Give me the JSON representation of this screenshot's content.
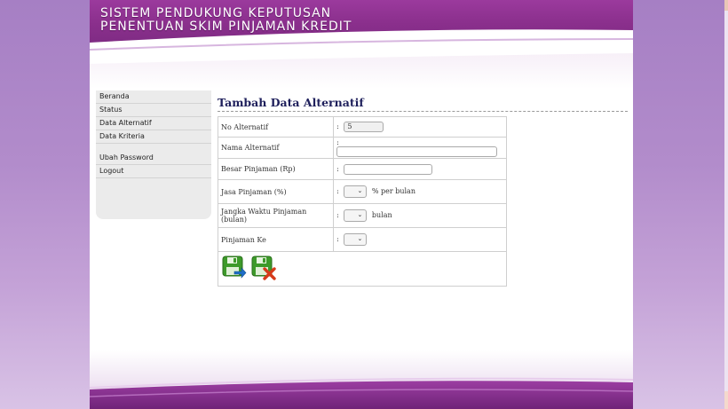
{
  "header": {
    "title_line1": "SISTEM PENDUKUNG KEPUTUSAN",
    "title_line2": "PENENTUAN SKIM PINJAMAN KREDIT"
  },
  "sidebar": {
    "items": [
      {
        "label": "Beranda"
      },
      {
        "label": "Status"
      },
      {
        "label": "Data Alternatif"
      },
      {
        "label": "Data Kriteria"
      },
      {
        "label": "Ubah Password"
      },
      {
        "label": "Logout"
      }
    ]
  },
  "main": {
    "title": "Tambah Data Alternatif",
    "form": {
      "no_alternatif": {
        "label": "No Alternatif",
        "value": "5"
      },
      "nama_alternatif": {
        "label": "Nama Alternatif",
        "value": ""
      },
      "besar_pinjaman": {
        "label": "Besar Pinjaman (Rp)",
        "value": ""
      },
      "jasa_pinjaman": {
        "label": "Jasa Pinjaman (%)",
        "selected": "",
        "unit": "% per bulan"
      },
      "jangka_waktu": {
        "label": "Jangka Waktu Pinjaman (bulan)",
        "selected": "",
        "unit": "bulan"
      },
      "pinjaman_ke": {
        "label": "Pinjaman Ke",
        "selected": ""
      },
      "separator": ":"
    },
    "actions": [
      {
        "icon": "save-icon"
      },
      {
        "icon": "cancel-icon"
      }
    ]
  },
  "colors": {
    "brand_purple": "#8a2f8c",
    "title_navy": "#1e1f5b",
    "save_green": "#3d9a2a",
    "cancel_red": "#d63a1a"
  }
}
